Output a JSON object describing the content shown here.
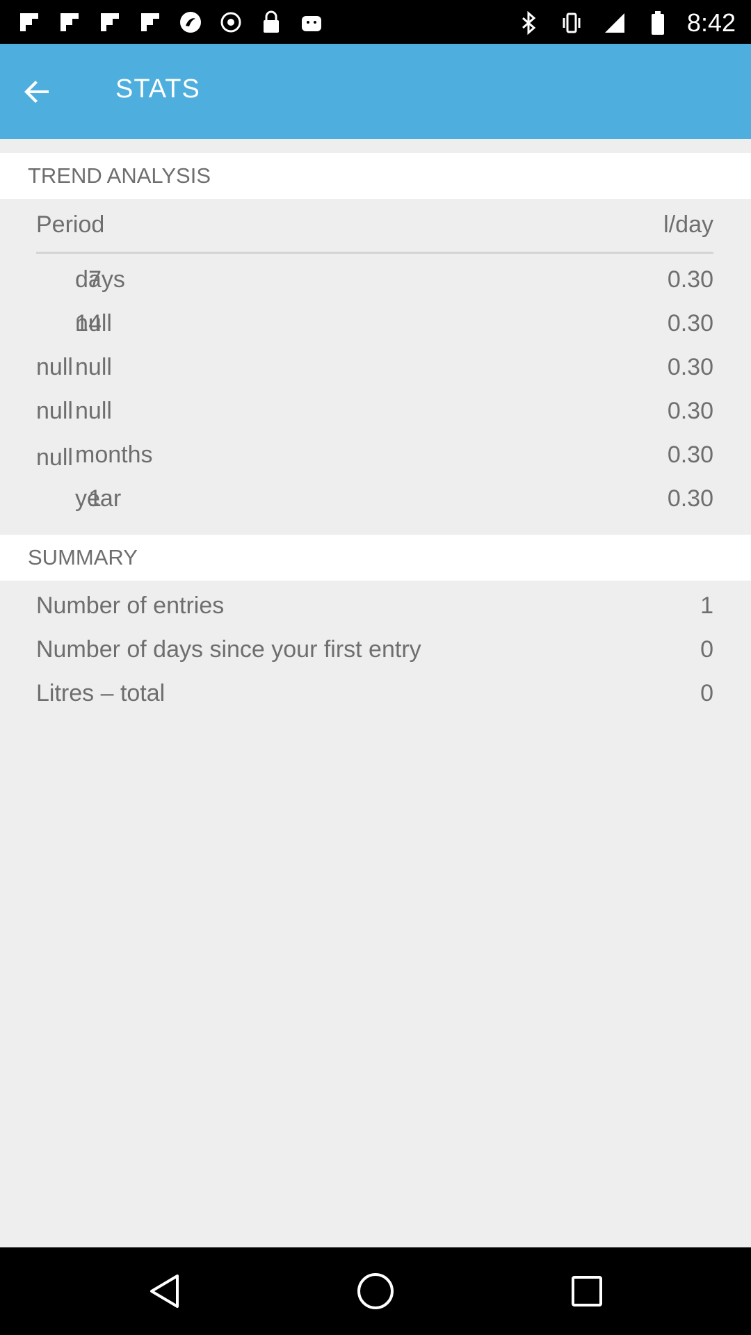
{
  "status_bar": {
    "time": "8:42",
    "icons": [
      "flipboard-icon",
      "flipboard-icon",
      "flipboard-icon",
      "flipboard-icon",
      "app-icon",
      "alarm-icon",
      "lock-icon",
      "android-icon",
      "bluetooth-icon",
      "vibrate-icon",
      "signal-icon",
      "battery-icon"
    ]
  },
  "app_bar": {
    "title": "STATS"
  },
  "trend": {
    "header": "TREND ANALYSIS",
    "col_period": "Period",
    "col_unit": "l/day",
    "rows": [
      {
        "num": "7",
        "unit": "days",
        "value": "0.30"
      },
      {
        "num": "14",
        "unit": "null",
        "value": "0.30"
      },
      {
        "num": "null",
        "unit": "null",
        "value": "0.30"
      },
      {
        "num": "null",
        "unit": "null",
        "value": "0.30"
      },
      {
        "num": "null",
        "unit": "months",
        "value": "0.30"
      },
      {
        "num": "1",
        "unit": "year",
        "value": "0.30"
      }
    ]
  },
  "summary": {
    "header": "SUMMARY",
    "rows": [
      {
        "label": "Number of entries",
        "value": "1"
      },
      {
        "label": "Number of days since your first entry",
        "value": "0"
      },
      {
        "label": "Litres – total",
        "value": "0"
      }
    ]
  },
  "colors": {
    "app_bar": "#4eaede",
    "background": "#eeeeee",
    "text": "#6e6e6e"
  }
}
